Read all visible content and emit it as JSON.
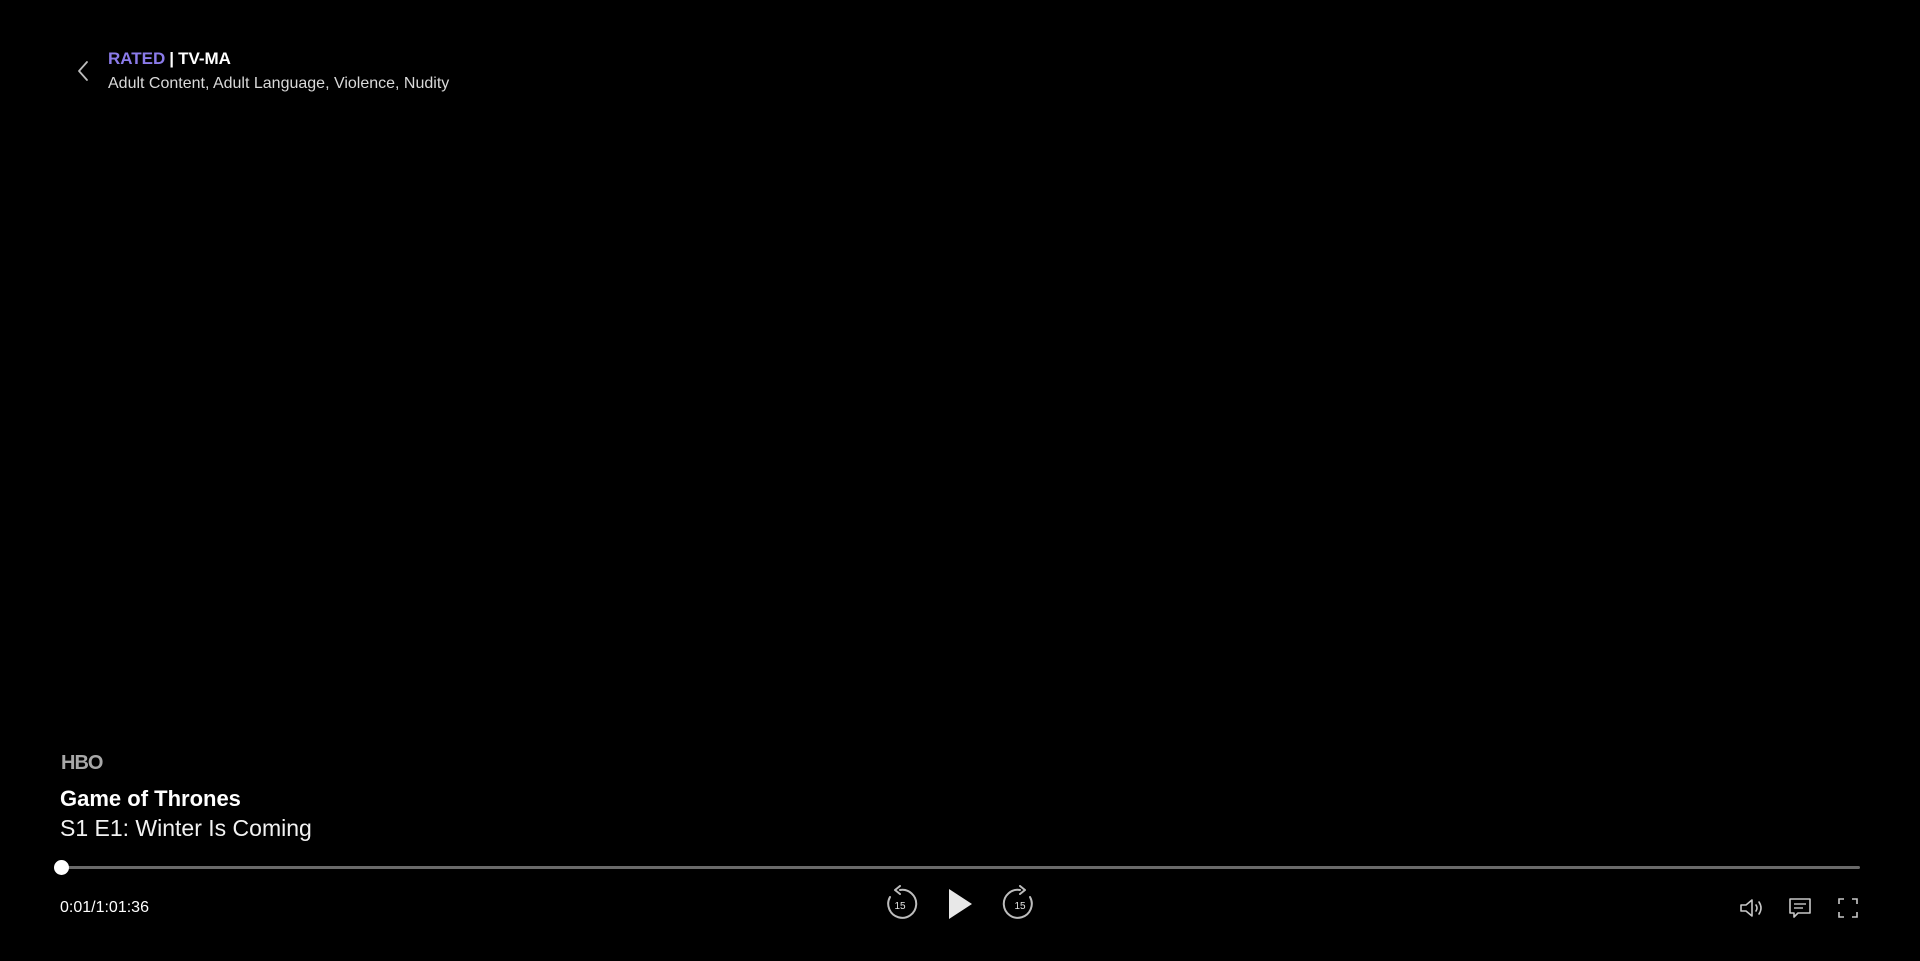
{
  "rating": {
    "label": "RATED",
    "separator": "|",
    "value": "TV-MA",
    "advisory": "Adult Content, Adult Language, Violence, Nudity",
    "label_color": "#8b7bea"
  },
  "network": {
    "logo_text": "HBO"
  },
  "episode": {
    "show_title": "Game of Thrones",
    "episode_title": "S1 E1: Winter Is Coming"
  },
  "playback": {
    "time_text": "0:01/1:01:36",
    "progress_fraction": 0.0003,
    "state": "paused"
  },
  "controls": {
    "skip_back_seconds": "15",
    "skip_forward_seconds": "15"
  },
  "icons": {
    "back": "chevron-left-icon",
    "rewind": "rewind-15-icon",
    "play": "play-icon",
    "forward": "forward-15-icon",
    "volume": "volume-icon",
    "subtitles": "subtitles-icon",
    "fullscreen": "fullscreen-icon"
  }
}
